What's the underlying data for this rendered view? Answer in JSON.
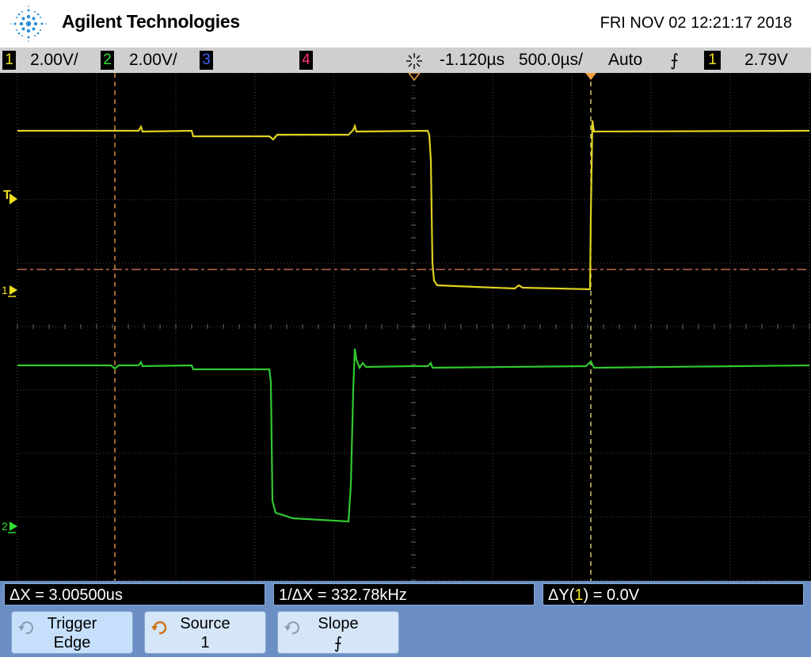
{
  "header": {
    "brand": "Agilent Technologies",
    "datetime": "FRI NOV 02 12:21:17 2018",
    "logo_icon": "agilent-spark-icon"
  },
  "status": {
    "ch1": {
      "num": "1",
      "scale": "2.00V/",
      "color": "#f0e020"
    },
    "ch2": {
      "num": "2",
      "scale": "2.00V/",
      "color": "#30e030"
    },
    "ch3": {
      "num": "3",
      "color": "#4060ff"
    },
    "ch4": {
      "num": "4",
      "color": "#ff3070"
    },
    "run_icon": "acquisition-icon",
    "delay": "-1.120µs",
    "timebase": "500.0µs/",
    "trigger_mode": "Auto",
    "trigger_slope": "⨍",
    "trigger_source": "1",
    "trigger_level": "2.79V"
  },
  "markers": {
    "trigger_level": "T",
    "ch1_ground": "1",
    "ch2_ground": "2"
  },
  "measurements": {
    "delta_x": "ΔX = 3.00500us",
    "inv_delta_x": "1/ΔX = 332.78kHz",
    "delta_y_prefix": "ΔY(",
    "delta_y_ch": "1",
    "delta_y_suffix": ") = 0.0V"
  },
  "softkeys": {
    "trigger": {
      "line1": "Trigger",
      "line2": "Edge",
      "icon": "rotate-knob-icon"
    },
    "source": {
      "line1": "Source",
      "line2": "1",
      "icon": "rotate-knob-icon"
    },
    "slope": {
      "line1": "Slope",
      "line2": "⨍",
      "icon": "rotate-knob-icon"
    }
  },
  "colors": {
    "ch1": "#e8d820",
    "ch2": "#30d830",
    "cursor": "#f0a040",
    "grid": "#5a5a5a",
    "accent_bar": "#6b8fc4"
  }
}
